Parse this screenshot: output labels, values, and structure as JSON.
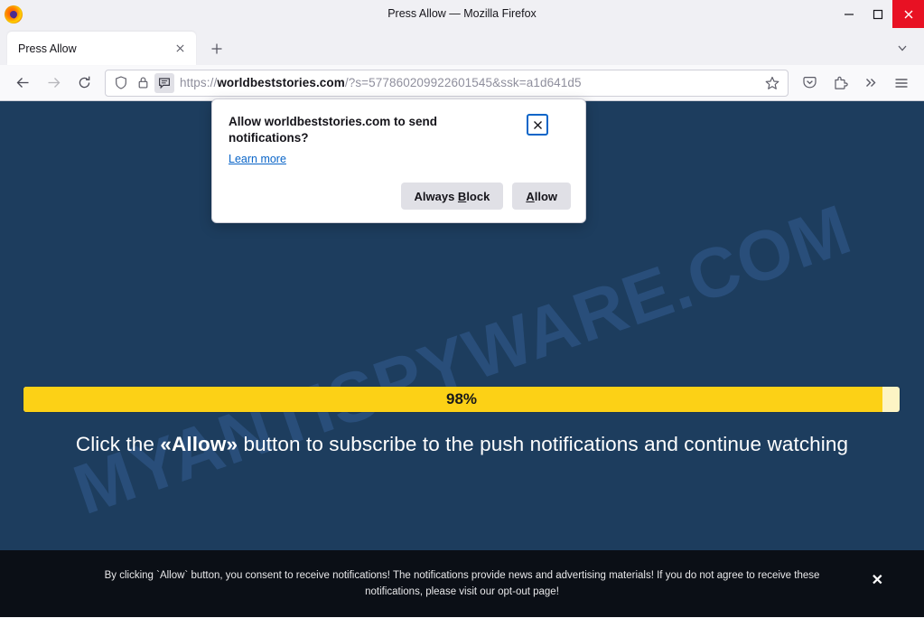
{
  "window": {
    "title": "Press Allow — Mozilla Firefox",
    "minimize_label": "Minimize",
    "maximize_label": "Maximize",
    "close_label": "Close"
  },
  "tabs": {
    "items": [
      {
        "label": "Press Allow",
        "close_label": "Close tab"
      }
    ],
    "new_tab_label": "New tab",
    "list_all_tabs_label": "List all tabs"
  },
  "toolbar": {
    "back_label": "Go back one page",
    "forward_label": "Go forward one page",
    "reload_label": "Reload current page",
    "shield_label": "Enhanced Tracking Protection",
    "lock_label": "Connection secure",
    "permission_label": "Notification permission requested",
    "bookmark_label": "Bookmark this page",
    "pocket_label": "Save to Pocket",
    "extensions_label": "Extensions",
    "overflow_label": "More tools",
    "menu_label": "Open application menu"
  },
  "urlbar": {
    "scheme": "https://",
    "host": "worldbeststories.com",
    "path": "/?s=577860209922601545&ssk=a1d641d5",
    "full": "https://worldbeststories.com/?s=577860209922601545&ssk=a1d641d5"
  },
  "permission_popup": {
    "title": "Allow worldbeststories.com to send notifications?",
    "learn_more": "Learn more",
    "close_label": "Close",
    "buttons": {
      "always_block_pre": "Always ",
      "always_block_accesskey": "B",
      "always_block_post": "lock",
      "allow_accesskey": "A",
      "allow_post": "llow"
    }
  },
  "page": {
    "watermark": "MYANTISPYWARE.COM",
    "progress": {
      "percent_label": "98%",
      "percent_value": 98
    },
    "cta_pre": "Click the ",
    "cta_bold": "«Allow»",
    "cta_post": " button to subscribe to the push notifications and continue watching",
    "background_color": "#1d3d5e",
    "progress_fill_color": "#fcd116",
    "progress_track_color": "#fdf4c4"
  },
  "consent_bar": {
    "text_main": "By clicking `Allow` button, you consent to receive notifications! The notifications provide news and advertising materials! If you do not agree to receive these notifications, please visit our ",
    "link_text": "opt-out page!",
    "close_label": "✕",
    "background_color": "#0b0f16"
  }
}
